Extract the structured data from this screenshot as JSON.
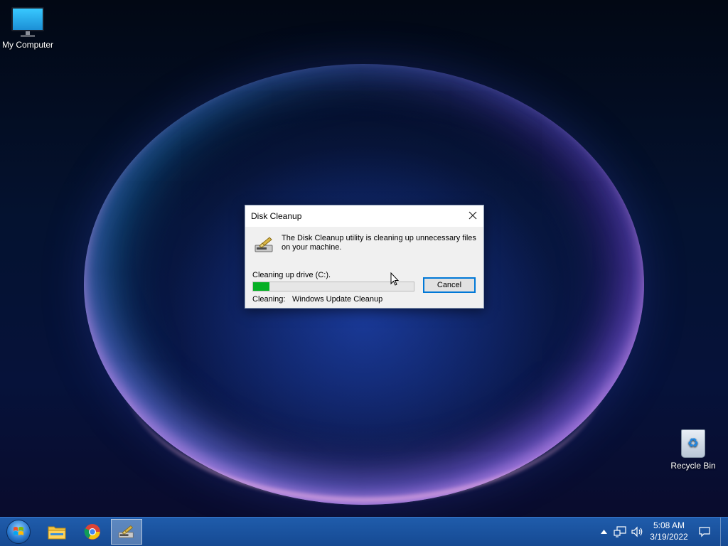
{
  "desktop": {
    "icons": [
      {
        "label": "My Computer",
        "icon": "monitor-icon"
      },
      {
        "label": "Recycle Bin",
        "icon": "recycle-bin-icon"
      }
    ]
  },
  "dialog": {
    "title": "Disk Cleanup",
    "message": "The Disk Cleanup utility is cleaning up unnecessary files on your machine.",
    "progress_label": "Cleaning up drive  (C:).",
    "progress_fraction": 0.1,
    "cleaning_label": "Cleaning:",
    "cleaning_item": "Windows Update Cleanup",
    "cancel_label": "Cancel",
    "close_icon": "close-icon"
  },
  "taskbar": {
    "start_icon": "windows-start-icon",
    "pinned": [
      {
        "icon": "file-explorer-icon"
      },
      {
        "icon": "chrome-icon"
      },
      {
        "icon": "disk-cleanup-icon",
        "active": true
      }
    ],
    "tray": {
      "icons": [
        "show-hidden-icons",
        "network-icon",
        "volume-icon",
        "notification-icon"
      ],
      "time": "5:08 AM",
      "date": "3/19/2022"
    }
  },
  "colors": {
    "progress_fill": "#06b025",
    "taskbar": "#1a52a0",
    "accent_border": "#0078d7"
  }
}
